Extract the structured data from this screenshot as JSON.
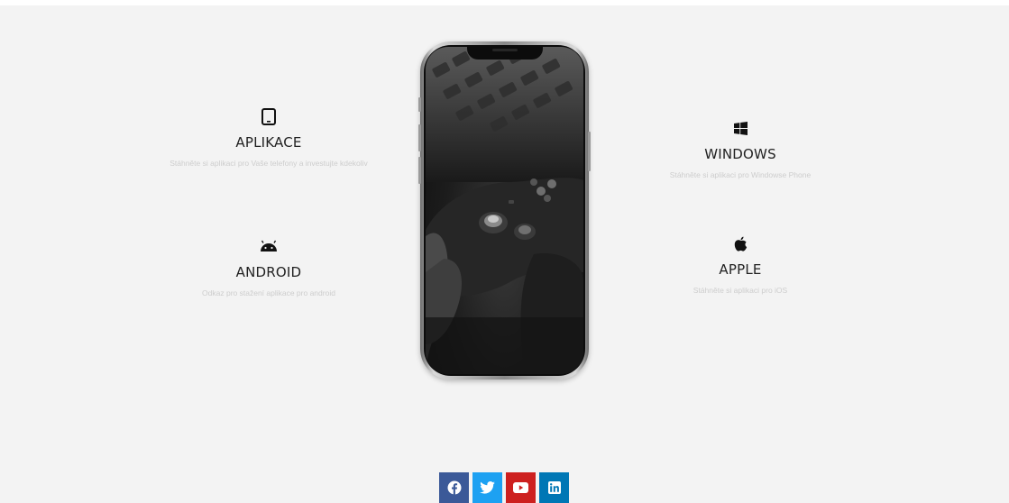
{
  "features": {
    "aplikace": {
      "icon": "tablet-icon",
      "title": "APLIKACE",
      "description": "Stáhněte si aplikaci pro Vaše telefony a investujte kdekoliv"
    },
    "android": {
      "icon": "android-icon",
      "title": "ANDROID",
      "description": "Odkaz pro stažení aplikace pro android"
    },
    "windows": {
      "icon": "windows-icon",
      "title": "WINDOWS",
      "description": "Stáhněte si aplikaci pro Windowse Phone"
    },
    "apple": {
      "icon": "apple-icon",
      "title": "APPLE",
      "description": "Stáhněte si aplikaci pro iOS"
    }
  },
  "phone": {
    "screen_image": "game-controller-photo"
  },
  "social": [
    {
      "icon": "facebook-icon",
      "color": "#3b5998"
    },
    {
      "icon": "twitter-icon",
      "color": "#1da1f2"
    },
    {
      "icon": "youtube-icon",
      "color": "#cd201f"
    },
    {
      "icon": "linkedin-icon",
      "color": "#0077b5"
    }
  ],
  "colors": {
    "section_background": "#f3f3f3",
    "title_text": "#222222",
    "description_text": "#cdcdcd"
  }
}
